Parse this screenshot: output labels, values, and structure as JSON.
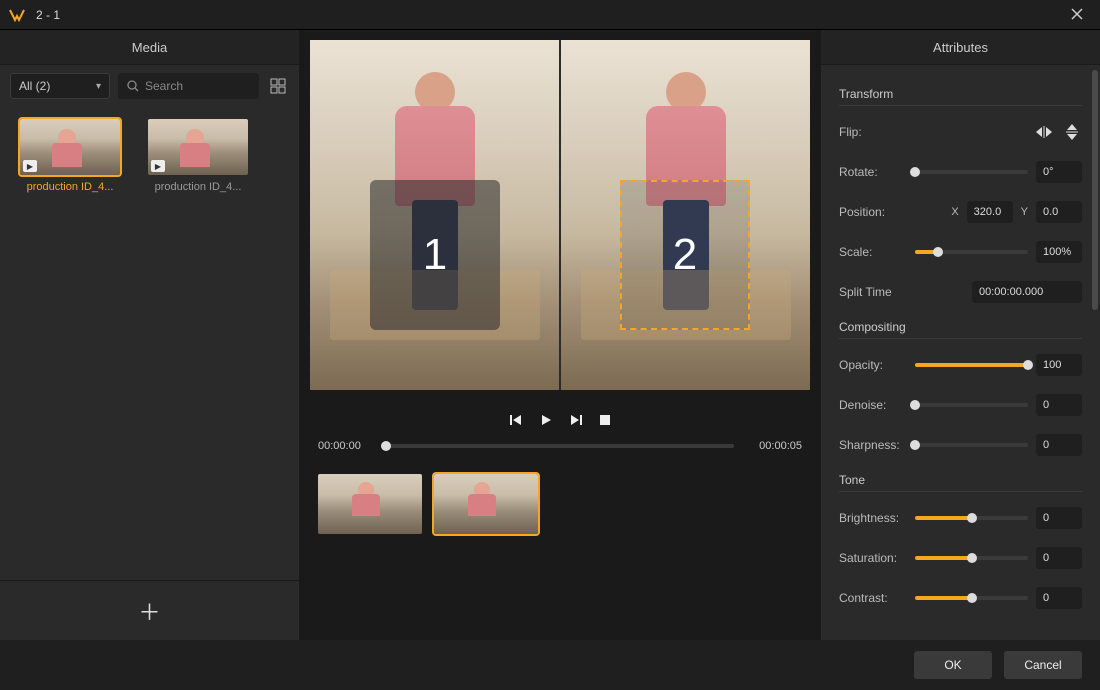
{
  "window": {
    "title": "2 - 1"
  },
  "media": {
    "panel_title": "Media",
    "filter_label": "All (2)",
    "search_placeholder": "Search",
    "items": [
      {
        "name": "production ID_4...",
        "selected": true
      },
      {
        "name": "production ID_4...",
        "selected": false
      }
    ]
  },
  "preview": {
    "marker1": "1",
    "marker2": "2"
  },
  "transport": {
    "time_current": "00:00:00",
    "time_total": "00:00:05"
  },
  "clips": [
    {
      "selected": false
    },
    {
      "selected": true
    }
  ],
  "attributes": {
    "panel_title": "Attributes",
    "transform": {
      "title": "Transform",
      "flip_label": "Flip:",
      "rotate_label": "Rotate:",
      "rotate_value": "0°",
      "rotate_pct": 0,
      "position_label": "Position:",
      "position_x_label": "X",
      "position_x": "320.0",
      "position_y_label": "Y",
      "position_y": "0.0",
      "scale_label": "Scale:",
      "scale_value": "100%",
      "scale_pct": 20,
      "split_label": "Split Time",
      "split_value": "00:00:00.000"
    },
    "compositing": {
      "title": "Compositing",
      "opacity_label": "Opacity:",
      "opacity_value": "100",
      "opacity_pct": 100,
      "denoise_label": "Denoise:",
      "denoise_value": "0",
      "denoise_pct": 0,
      "sharpness_label": "Sharpness:",
      "sharpness_value": "0",
      "sharpness_pct": 0
    },
    "tone": {
      "title": "Tone",
      "brightness_label": "Brightness:",
      "brightness_value": "0",
      "brightness_pct": 50,
      "saturation_label": "Saturation:",
      "saturation_value": "0",
      "saturation_pct": 50,
      "contrast_label": "Contrast:",
      "contrast_value": "0",
      "contrast_pct": 50
    }
  },
  "footer": {
    "ok": "OK",
    "cancel": "Cancel"
  }
}
